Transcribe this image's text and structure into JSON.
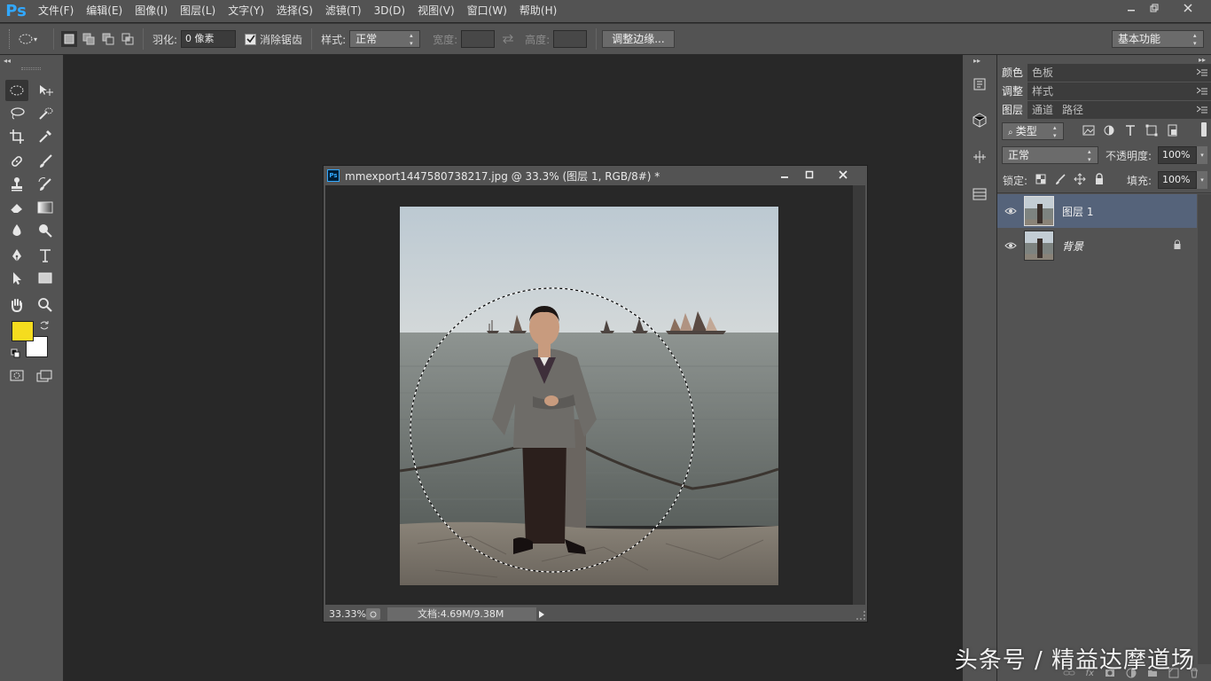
{
  "app": {
    "logo": "Ps"
  },
  "menu": [
    "文件(F)",
    "编辑(E)",
    "图像(I)",
    "图层(L)",
    "文字(Y)",
    "选择(S)",
    "滤镜(T)",
    "3D(D)",
    "视图(V)",
    "窗口(W)",
    "帮助(H)"
  ],
  "options": {
    "feather_label": "羽化:",
    "feather_value": "0 像素",
    "antialias_label": "消除锯齿",
    "style_label": "样式:",
    "style_value": "正常",
    "width_label": "宽度:",
    "height_label": "高度:",
    "refine_button": "调整边缘...",
    "workspace": "基本功能"
  },
  "colors": {
    "foreground": "#f5dc1e",
    "background": "#ffffff",
    "accent": "#31a8ff"
  },
  "document": {
    "title": "mmexport1447580738217.jpg @ 33.3% (图层 1, RGB/8#) *",
    "zoom": "33.33%",
    "doc_size": "文档:4.69M/9.38M"
  },
  "panels": {
    "tabs_top": [
      "颜色",
      "色板"
    ],
    "tabs_mid": [
      "调整",
      "样式"
    ],
    "tabs_layers": [
      "图层",
      "通道",
      "路径"
    ],
    "filter_type": "类型",
    "blend_mode": "正常",
    "opacity_label": "不透明度:",
    "opacity_value": "100%",
    "lock_label": "锁定:",
    "fill_label": "填充:",
    "fill_value": "100%",
    "layers": [
      {
        "name": "图层 1",
        "selected": true
      },
      {
        "name": "背景",
        "selected": false
      }
    ]
  },
  "watermark": "头条号 / 精益达摩道场"
}
